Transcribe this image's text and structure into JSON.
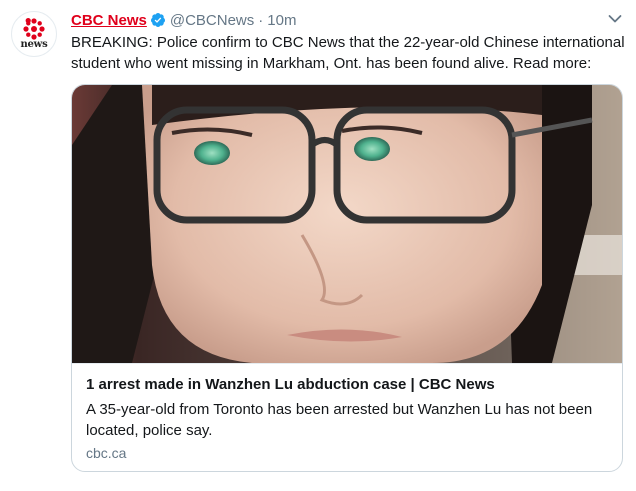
{
  "tweet": {
    "avatar_text": "news",
    "name": "CBC News",
    "handle": "@CBCNews",
    "separator": "·",
    "time": "10m",
    "text": "BREAKING: Police confirm to CBC News that the 22-year-old Chinese international student who went missing in Markham, Ont. has been found alive. Read more:",
    "card": {
      "title": "1 arrest made in Wanzhen Lu abduction case | CBC News",
      "description": "A 35-year-old from Toronto has been arrested but Wanzhen Lu has not been located, police say.",
      "domain": "cbc.ca"
    }
  },
  "colors": {
    "brand": "#e0001b",
    "verified": "#1da1f2",
    "secondary_text": "#657786",
    "border": "#ccd6dd"
  },
  "icons": {
    "avatar": "cbc-gem-icon",
    "verified": "verified-badge-icon",
    "menu": "chevron-down-icon"
  }
}
